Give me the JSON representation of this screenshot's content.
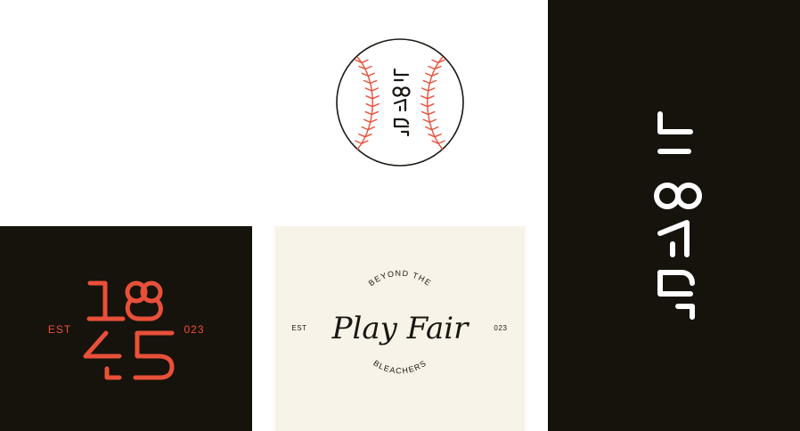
{
  "colors": {
    "accent": "#e8503a",
    "dark": "#16130c",
    "cream": "#f8f3e9",
    "ink": "#1a1712",
    "white": "#ffffff"
  },
  "logo": {
    "year_top": "18",
    "year_bottom": "45",
    "est_label": "EST",
    "year_suffix": "023"
  },
  "playfair": {
    "arc_top": "BEYOND THE",
    "script_title": "Play Fair",
    "arc_bottom": "BLEACHERS",
    "est_label": "EST",
    "year_suffix": "023"
  }
}
